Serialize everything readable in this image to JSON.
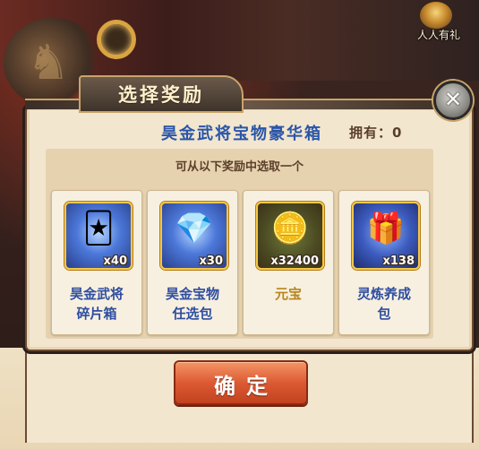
{
  "dialog": {
    "title": "选择奖励",
    "item_name": "昊金武将宝物豪华箱",
    "owned_label": "拥有：",
    "owned_value": "0",
    "hint": "可从以下奖励中选取一个",
    "close_glyph": "✕",
    "confirm_label": "确定"
  },
  "top_right": {
    "label": "人人有礼"
  },
  "rewards": [
    {
      "name_line1": "昊金武将",
      "name_line2": "碎片箱",
      "count": "x40",
      "icon": "general-shard-box-icon",
      "glyph": "🃏"
    },
    {
      "name_line1": "昊金宝物",
      "name_line2": "任选包",
      "count": "x30",
      "icon": "treasure-pack-icon",
      "glyph": "💎"
    },
    {
      "name_line1": "元宝",
      "name_line2": "",
      "count": "x32400",
      "icon": "gold-ingot-icon",
      "glyph": "🪙"
    },
    {
      "name_line1": "灵炼养成",
      "name_line2": "包",
      "count": "x138",
      "icon": "spirit-refine-pack-icon",
      "glyph": "🎁"
    }
  ],
  "colors": {
    "accent_blue": "#2a55a8",
    "gold_text": "#b8861c",
    "button": "#dc5a33"
  }
}
